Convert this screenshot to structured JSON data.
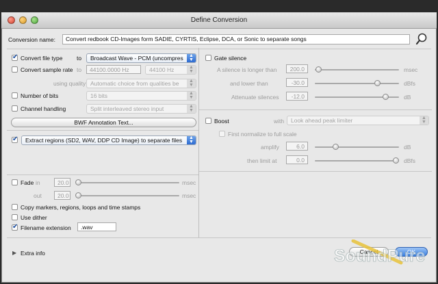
{
  "window": {
    "title": "Define Conversion"
  },
  "conversion_name": {
    "label": "Conversion name:",
    "value": "Convert redbook CD-Images form SADIE, CYRTIS, Eclipse, DCA, or Sonic to separate songs"
  },
  "left": {
    "convert_file_type": {
      "label": "Convert file type",
      "to": "to",
      "value": "Broadcast Wave - PCM (uncompres",
      "checked": true
    },
    "convert_sample_rate": {
      "label": "Convert sample rate",
      "to": "to",
      "value": "44100.0000 Hz",
      "select": "44100 Hz",
      "checked": false
    },
    "using_quality": {
      "label": "using quality",
      "value": "Automatic choice from qualities be"
    },
    "number_of_bits": {
      "label": "Number of bits",
      "value": "16 bits",
      "checked": false
    },
    "channel_handling": {
      "label": "Channel handling",
      "value": "Split interleaved stereo input",
      "checked": false
    },
    "bwf_button": "BWF Annotation Text...",
    "extract_regions": {
      "value": "Extract regions (SD2, WAV, DDP CD Image) to separate files",
      "checked": true
    },
    "fade": {
      "label": "Fade",
      "in_label": "in",
      "in_value": "20.0",
      "out_label": "out",
      "out_value": "20.0",
      "unit": "msec",
      "checked": false
    },
    "copy_markers": {
      "label": "Copy markers, regions, loops and time stamps",
      "checked": false
    },
    "use_dither": {
      "label": "Use dither",
      "checked": false
    },
    "filename_extension": {
      "label": "Filename extension",
      "value": ".wav",
      "checked": true
    }
  },
  "right": {
    "gate_silence": {
      "label": "Gate silence",
      "checked": false
    },
    "silence_longer": {
      "label": "A silence is longer than",
      "value": "200.0",
      "unit": "msec"
    },
    "and_lower": {
      "label": "and lower than",
      "value": "-30.0",
      "unit": "dBfs"
    },
    "attenuate": {
      "label": "Attenuate silences",
      "value": "-12.0",
      "unit": "dB"
    },
    "boost": {
      "label": "Boost",
      "with": "with",
      "value": "Look ahead peak limiter",
      "checked": false
    },
    "first_normalize": {
      "label": "First normalize to full scale",
      "checked": false
    },
    "amplify": {
      "label": "amplify",
      "value": "6.0",
      "unit": "dB"
    },
    "limit_at": {
      "label": "then limit at",
      "value": "0.0",
      "unit": "dBfs"
    }
  },
  "footer": {
    "extra_info": "Extra info",
    "cancel": "Cancel",
    "ok": "OK"
  },
  "watermark": "SoundPure"
}
